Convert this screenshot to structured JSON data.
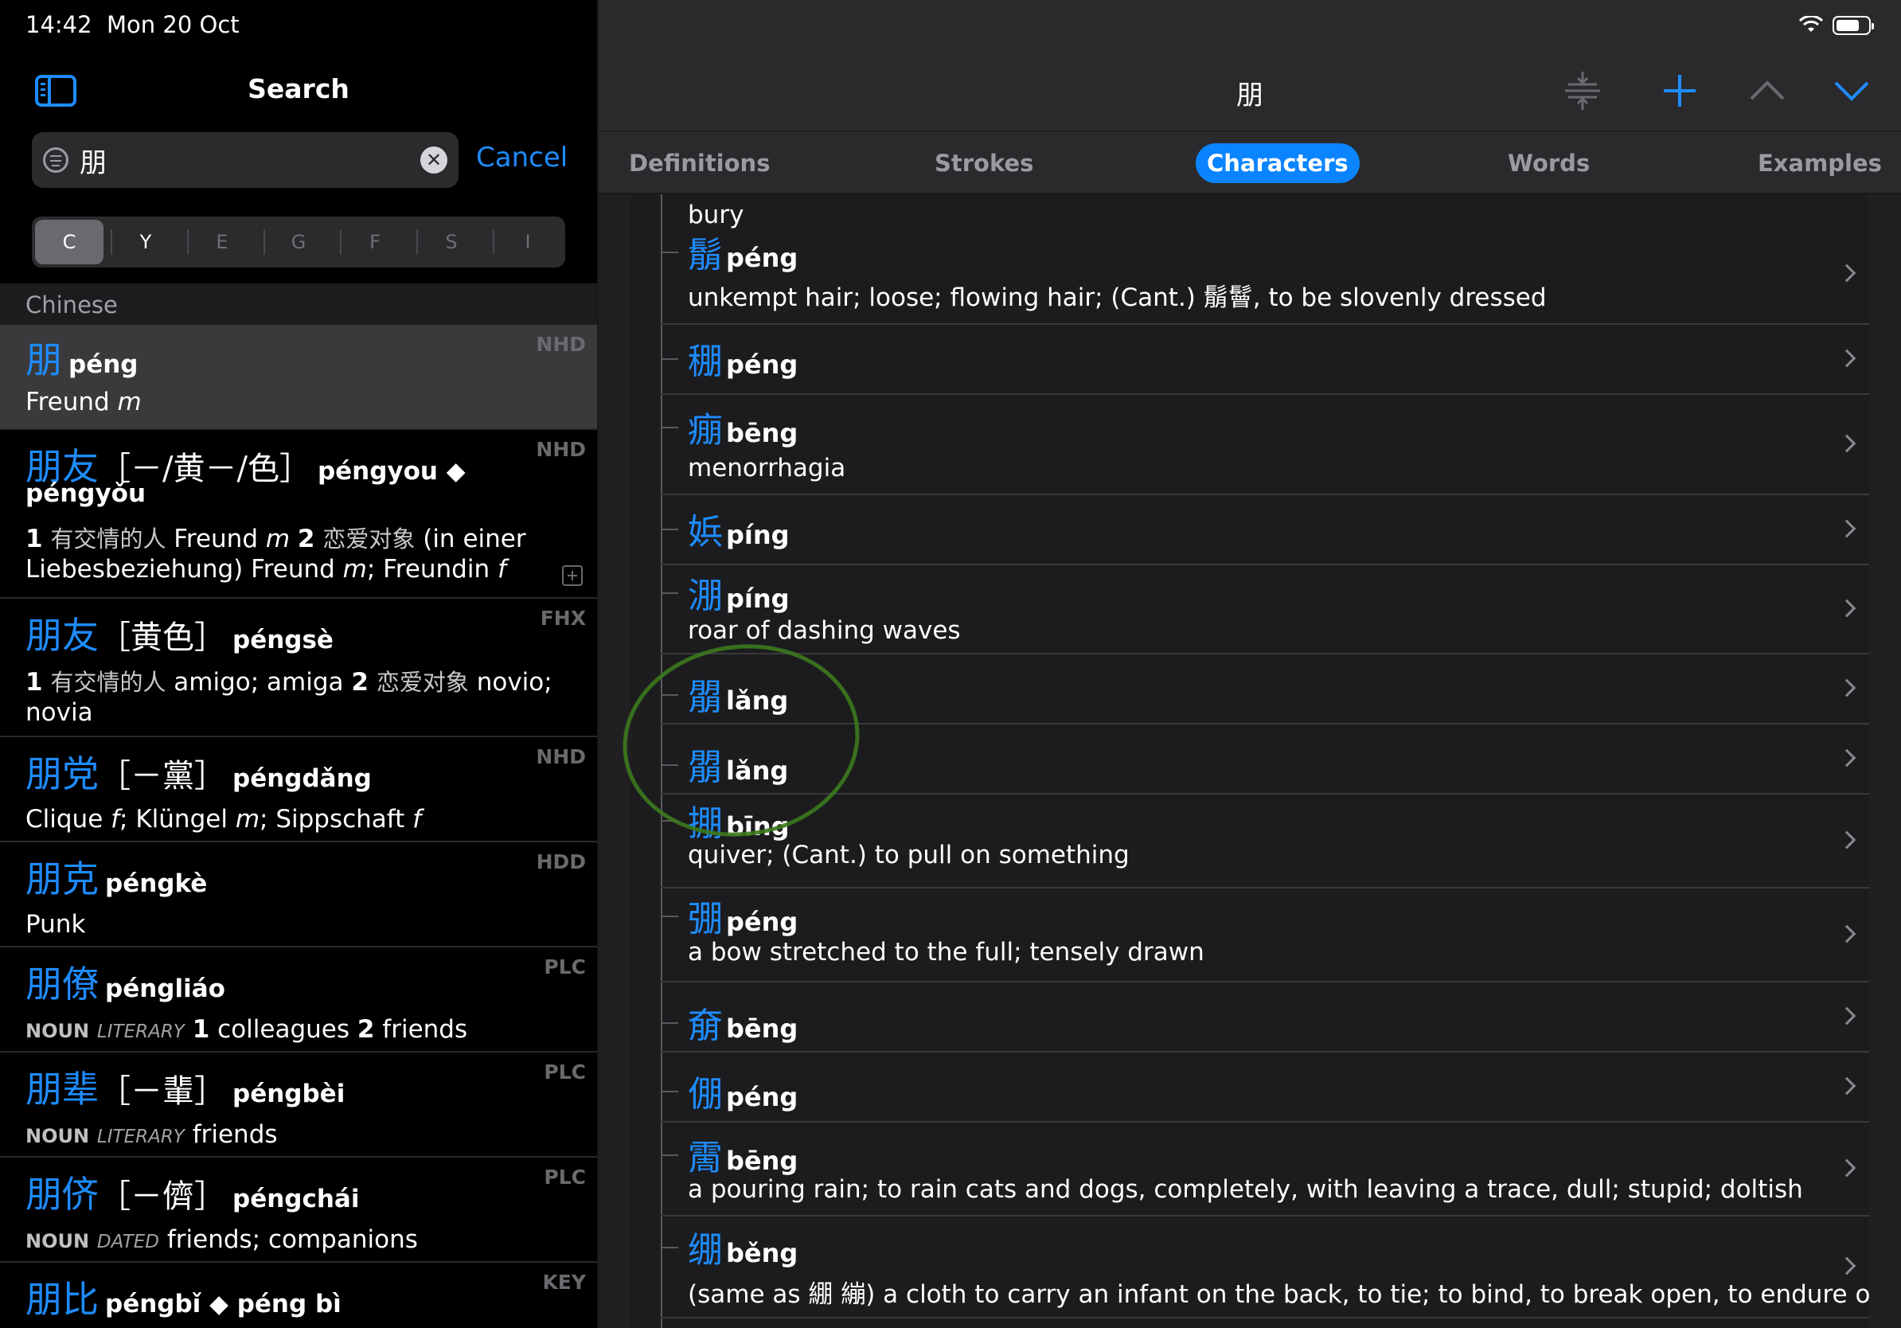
{
  "status_bar": {
    "time": "14:42",
    "date": "Mon 20 Oct"
  },
  "left": {
    "title": "Search",
    "search": {
      "value": "朋",
      "clear_glyph": "✕"
    },
    "cancel_label": "Cancel",
    "segments": [
      {
        "label": "C",
        "active": true
      },
      {
        "label": "Y",
        "active": false
      },
      {
        "label": "E",
        "active": false
      },
      {
        "label": "G",
        "active": false
      },
      {
        "label": "F",
        "active": false
      },
      {
        "label": "S",
        "active": false
      },
      {
        "label": "I",
        "active": false
      }
    ],
    "section_header": "Chinese",
    "results": [
      {
        "hanzi": "朋",
        "extra": "",
        "pinyin": "péng",
        "source": "NHD",
        "def_html": "Freund <i>m</i>"
      },
      {
        "hanzi": "朋友",
        "extra": "［－/黄－/色］",
        "pinyin": "péngyou ◆",
        "pinyin2": "péngyǒu",
        "source": "NHD",
        "def_html": "<b>1</b> <span class='cn'>有交情的人</span> Freund <i>m</i> <b>2</b> <span class='cn'>恋爱对象</span> (in einer Liebesbeziehung) Freund <i>m</i>; Freundin <i>f</i>"
      },
      {
        "hanzi": "朋友",
        "extra": "［黄色］",
        "pinyin": "péngsè",
        "source": "FHX",
        "def_html": "<b>1</b> <span class='cn'>有交情的人</span> amigo; amiga <b>2</b> <span class='cn'>恋爱对象</span> novio; novia"
      },
      {
        "hanzi": "朋党",
        "extra": "［－黨］",
        "pinyin": "péngdǎng",
        "source": "NHD",
        "def_html": "Clique <i>f</i>; Klüngel <i>m</i>; Sippschaft <i>f</i>"
      },
      {
        "hanzi": "朋克",
        "extra": "",
        "pinyin": "péngkè",
        "source": "HDD",
        "def_html": "Punk"
      },
      {
        "hanzi": "朋僚",
        "extra": "",
        "pinyin": "péngliáo",
        "source": "PLC",
        "def_html": "<span class='pos'>NOUN</span> <span class='reg'>LITERARY</span> <b>1</b> colleagues <b>2</b> friends"
      },
      {
        "hanzi": "朋辈",
        "extra": "［－輩］",
        "pinyin": "péngbèi",
        "source": "PLC",
        "def_html": "<span class='pos'>NOUN</span> <span class='reg'>LITERARY</span> friends"
      },
      {
        "hanzi": "朋侪",
        "extra": "［－儕］",
        "pinyin": "péngchái",
        "source": "PLC",
        "def_html": "<span class='pos'>NOUN</span> <span class='reg'>DATED</span> friends; companions"
      },
      {
        "hanzi": "朋比",
        "extra": "",
        "pinyin": "péngbǐ ◆ péng bì",
        "source": "KEY",
        "def_html": ""
      }
    ]
  },
  "right": {
    "entry_title": "朋",
    "tabs": [
      {
        "label": "Definitions",
        "active": false
      },
      {
        "label": "Strokes",
        "active": false
      },
      {
        "label": "Characters",
        "active": true
      },
      {
        "label": "Words",
        "active": false
      },
      {
        "label": "Examples",
        "active": false
      }
    ],
    "top_fragment": "bury",
    "characters": [
      {
        "hanzi": "鬅",
        "pinyin": "péng",
        "def": "unkempt hair; loose; flowing hair; (Cant.) 鬅鬙, to be slovenly dressed"
      },
      {
        "hanzi": "稝",
        "pinyin": "péng",
        "def": ""
      },
      {
        "hanzi": "痭",
        "pinyin": "bēng",
        "def": "menorrhagia"
      },
      {
        "hanzi": "娦",
        "pinyin": "píng",
        "def": ""
      },
      {
        "hanzi": "淜",
        "pinyin": "píng",
        "def": "roar of dashing waves"
      },
      {
        "hanzi": "朤",
        "pinyin": "lǎng",
        "def": ""
      },
      {
        "hanzi": "朤",
        "pinyin": "lǎng",
        "def": ""
      },
      {
        "hanzi": "掤",
        "pinyin": "bīng",
        "def": "quiver; (Cant.) to pull on something"
      },
      {
        "hanzi": "弸",
        "pinyin": "péng",
        "def": "a bow stretched to the full; tensely drawn"
      },
      {
        "hanzi": "奟",
        "pinyin": "bēng",
        "def": ""
      },
      {
        "hanzi": "倗",
        "pinyin": "péng",
        "def": ""
      },
      {
        "hanzi": "霌",
        "pinyin": "bēng",
        "def": "a pouring rain; to rain cats and dogs, completely, with leaving a trace, dull; stupid; doltish"
      },
      {
        "hanzi": "绷",
        "pinyin": "běng",
        "def": "(same as 綳 繃) a cloth to carry an infant on the back, to tie; to bind, to break open, to endure or bear"
      }
    ]
  },
  "colors": {
    "accent": "#1e8cff",
    "tab_active": "#0a84ff",
    "annotation": "#3c7a1e"
  }
}
